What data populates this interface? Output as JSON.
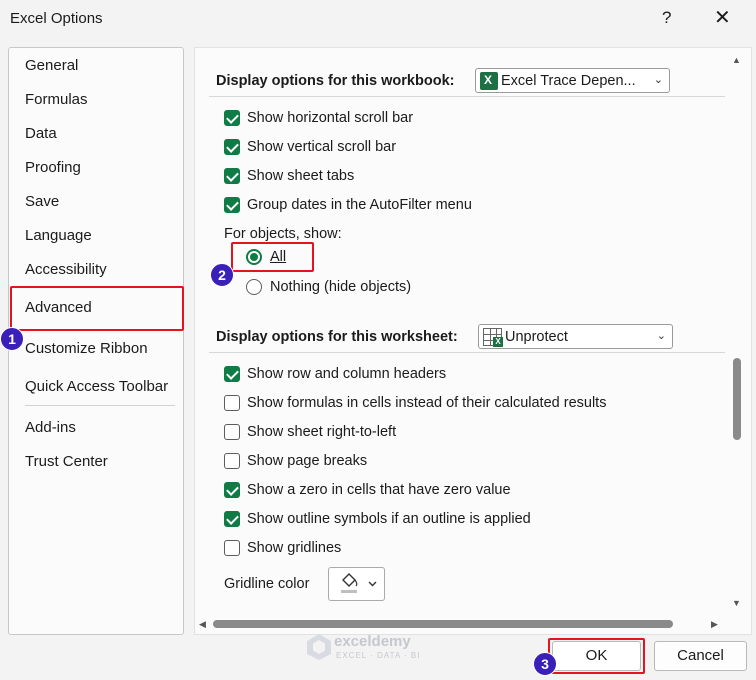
{
  "window": {
    "title": "Excel Options",
    "help_label": "?",
    "close_label": "✕"
  },
  "sidebar": {
    "items": [
      {
        "label": "General"
      },
      {
        "label": "Formulas"
      },
      {
        "label": "Data"
      },
      {
        "label": "Proofing"
      },
      {
        "label": "Save"
      },
      {
        "label": "Language"
      },
      {
        "label": "Accessibility"
      },
      {
        "label": "Advanced"
      },
      {
        "label": "Customize Ribbon"
      },
      {
        "label": "Quick Access Toolbar"
      },
      {
        "label": "Add-ins"
      },
      {
        "label": "Trust Center"
      }
    ],
    "selected": "Advanced"
  },
  "workbook_section": {
    "title": "Display options for this workbook:",
    "selected_workbook": "Excel Trace Depen...",
    "options": [
      {
        "label": "Show horizontal scroll bar",
        "checked": true
      },
      {
        "label": "Show vertical scroll bar",
        "checked": true
      },
      {
        "label": "Show sheet tabs",
        "checked": true
      },
      {
        "label": "Group dates in the AutoFilter menu",
        "checked": true
      }
    ],
    "objects_label": "For objects, show:",
    "radio_all": "All",
    "radio_nothing": "Nothing (hide objects)",
    "selected_radio": "All"
  },
  "worksheet_section": {
    "title": "Display options for this worksheet:",
    "selected_sheet": "Unprotect",
    "options": [
      {
        "label": "Show row and column headers",
        "checked": true
      },
      {
        "label": "Show formulas in cells instead of their calculated results",
        "checked": false
      },
      {
        "label": "Show sheet right-to-left",
        "checked": false
      },
      {
        "label": "Show page breaks",
        "checked": false
      },
      {
        "label": "Show a zero in cells that have zero value",
        "checked": true
      },
      {
        "label": "Show outline symbols if an outline is applied",
        "checked": true
      },
      {
        "label": "Show gridlines",
        "checked": false
      }
    ],
    "gridline_color_label": "Gridline color"
  },
  "steps": {
    "one": "1",
    "two": "2",
    "three": "3"
  },
  "buttons": {
    "ok": "OK",
    "cancel": "Cancel"
  },
  "watermark": {
    "name": "exceldemy",
    "tagline": "EXCEL · DATA · BI"
  },
  "colors": {
    "accent_green": "#0f7b45",
    "highlight_red": "#e3131f",
    "step_badge": "#3a1fb8",
    "excel_green": "#1d7044"
  }
}
